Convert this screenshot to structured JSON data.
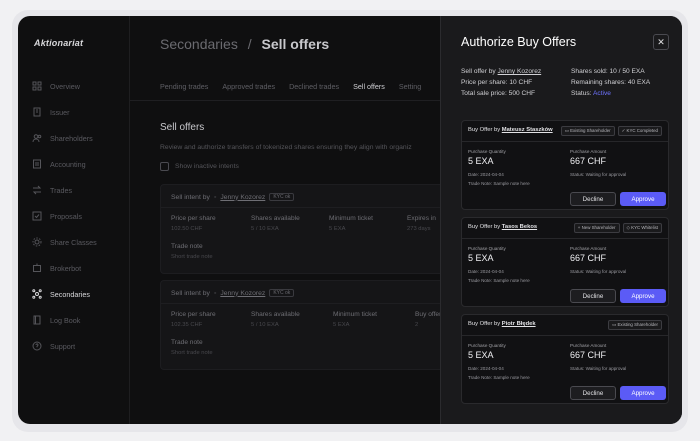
{
  "app": {
    "logo": "Aktionariat"
  },
  "sidebar": {
    "items": [
      {
        "label": "Overview",
        "icon": "grid-icon"
      },
      {
        "label": "Issuer",
        "icon": "building-icon"
      },
      {
        "label": "Shareholders",
        "icon": "users-icon"
      },
      {
        "label": "Accounting",
        "icon": "ledger-icon"
      },
      {
        "label": "Trades",
        "icon": "swap-icon"
      },
      {
        "label": "Proposals",
        "icon": "checkbox-icon"
      },
      {
        "label": "Share Classes",
        "icon": "gear-icon"
      },
      {
        "label": "Brokerbot",
        "icon": "bot-icon"
      },
      {
        "label": "Secondaries",
        "icon": "network-icon",
        "active": true
      },
      {
        "label": "Log Book",
        "icon": "book-icon"
      },
      {
        "label": "Support",
        "icon": "help-icon"
      }
    ]
  },
  "header": {
    "section": "Secondaries",
    "separator": "/",
    "page": "Sell offers"
  },
  "tabs": [
    "Pending trades",
    "Approved trades",
    "Declined trades",
    "Sell offers",
    "Setting"
  ],
  "main": {
    "title": "Sell offers",
    "description": "Review and authorize transfers of tokenized shares ensuring they align with organiz",
    "show_inactive": "Show inactive intents",
    "intents": [
      {
        "prefix": "Sell intent by",
        "owner": "Jenny Kozorez",
        "kyc": "KYC ok",
        "cols": [
          {
            "label": "Price per share",
            "value": "102.50 CHF"
          },
          {
            "label": "Shares available",
            "value": "5 / 10 EXA"
          },
          {
            "label": "Minimum ticket",
            "value": "5 EXA"
          },
          {
            "label": "Expires in",
            "value": "273 days"
          }
        ],
        "trade_note_label": "Trade note",
        "trade_note": "Short trade note"
      },
      {
        "prefix": "Sell intent by",
        "owner": "Jenny Kozorez",
        "kyc": "KYC ok",
        "cols": [
          {
            "label": "Price per share",
            "value": "102.35 CHF"
          },
          {
            "label": "Shares available",
            "value": "5 / 10 EXA"
          },
          {
            "label": "Minimum ticket",
            "value": "5 EXA"
          },
          {
            "label": "Buy offer",
            "value": "2"
          }
        ],
        "trade_note_label": "Trade note",
        "trade_note": "Short trade note"
      }
    ]
  },
  "drawer": {
    "title": "Authorize Buy Offers",
    "close_symbol": "✕",
    "summary_left": {
      "sell_offer_label": "Sell offer by",
      "sell_offer_owner": "Jenny Kozorez",
      "price_label": "Price per share:",
      "price": "10 CHF",
      "total_label": "Total sale price:",
      "total": "500 CHF"
    },
    "summary_right": {
      "sold_label": "Shares sold:",
      "sold": "10 / 50 EXA",
      "remaining_label": "Remaining shares:",
      "remaining": "40 EXA",
      "status_label": "Status:",
      "status": "Active"
    },
    "offers": [
      {
        "by_label": "Buy Offer by",
        "buyer": "Mateusz Staszków",
        "badges": [
          {
            "text": "Existing Shareholder",
            "icon": "id-card-icon"
          },
          {
            "text": "KYC Completed",
            "icon": "check-circle-icon"
          }
        ],
        "qty_label": "Purchase Quantity",
        "qty": "5 EXA",
        "amount_label": "Purchase Amount",
        "amount": "667 CHF",
        "date": "Date: 2024-04-04",
        "status": "Status: Waiting for approval",
        "note": "Trade Note: Sample note here",
        "decline": "Decline",
        "approve": "Approve"
      },
      {
        "by_label": "Buy Offer by",
        "buyer": "Tasos Bekos",
        "badges": [
          {
            "text": "New Shareholder",
            "icon": "user-plus-icon"
          },
          {
            "text": "KYC Whitelist",
            "icon": "shield-icon"
          }
        ],
        "qty_label": "Purchase Quantity",
        "qty": "5 EXA",
        "amount_label": "Purchase Amount",
        "amount": "667 CHF",
        "date": "Date: 2024-04-04",
        "status": "Status: Waiting for approval",
        "note": "Trade Note: Sample note here",
        "decline": "Decline",
        "approve": "Approve"
      },
      {
        "by_label": "Buy Offer by",
        "buyer": "Piotr Błędek",
        "badges": [
          {
            "text": "Existing Shareholder",
            "icon": "id-card-icon"
          }
        ],
        "qty_label": "Purchase Quantity",
        "qty": "5 EXA",
        "amount_label": "Purchase Amount",
        "amount": "667 CHF",
        "date": "Date: 2024-04-04",
        "status": "Status: Waiting for approval",
        "note": "Trade Note: Sample note here",
        "decline": "Decline",
        "approve": "Approve"
      }
    ]
  }
}
